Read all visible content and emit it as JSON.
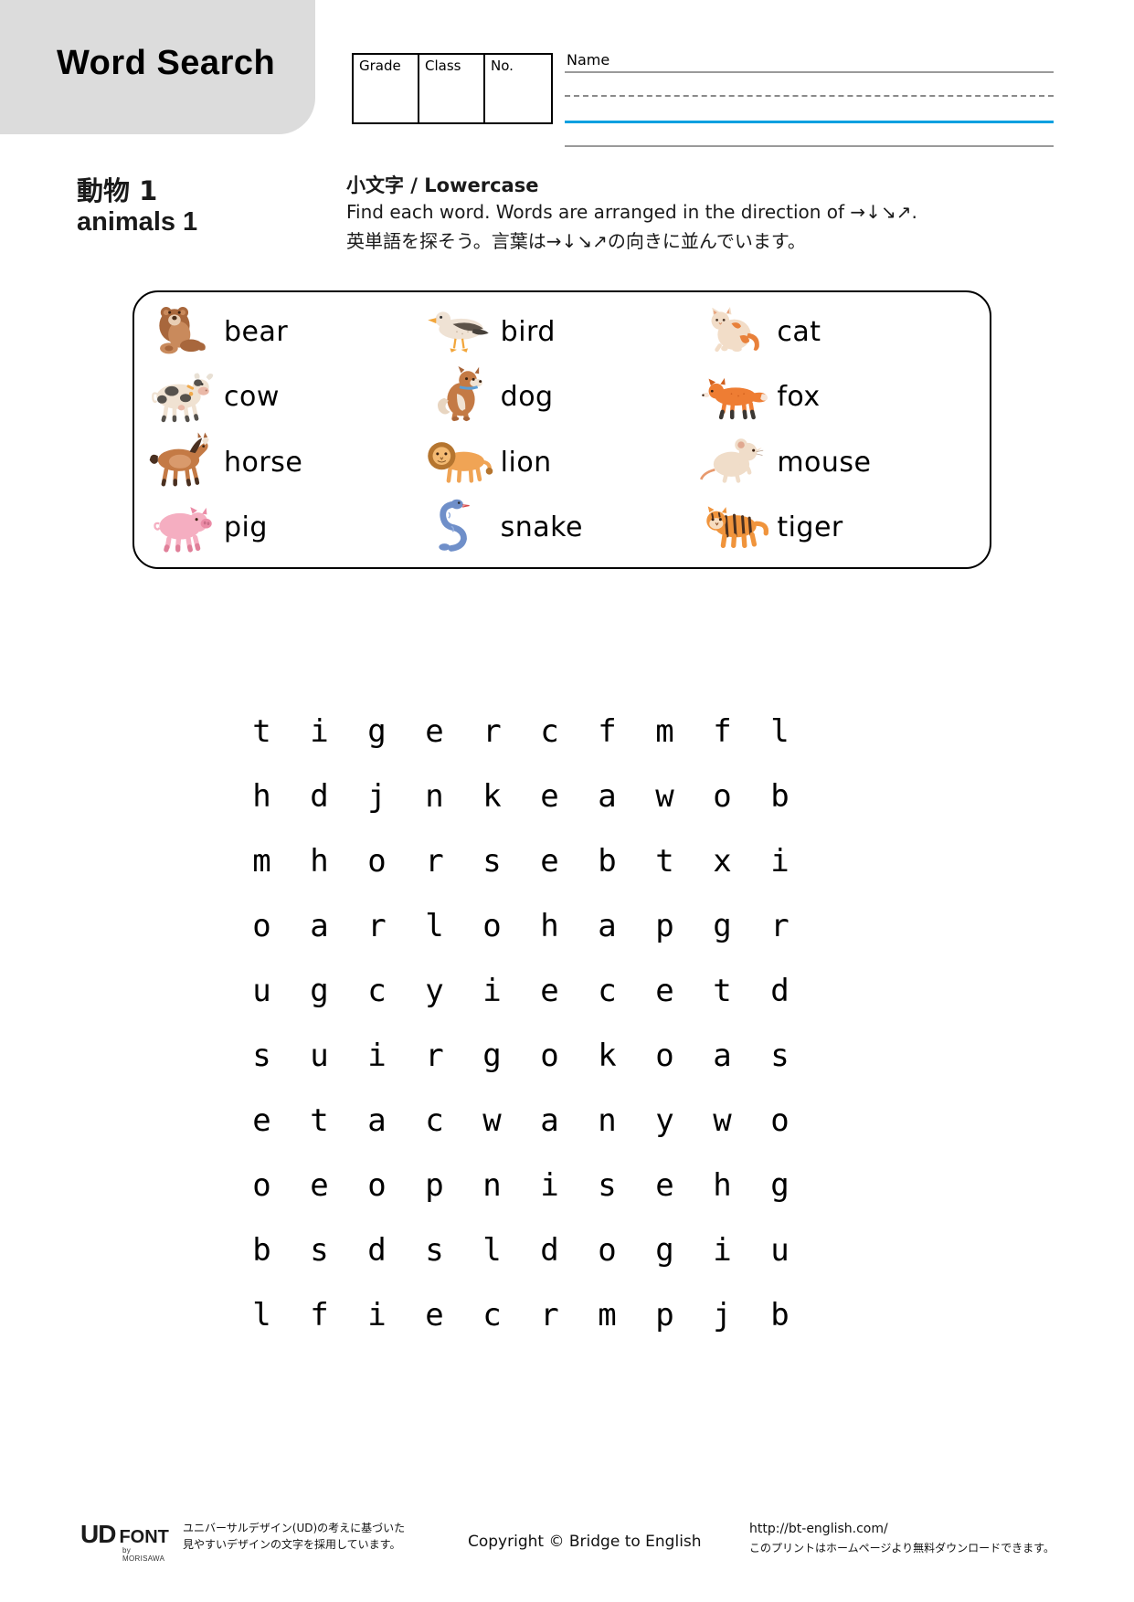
{
  "header": {
    "title": "Word Search",
    "fields": [
      {
        "label": "Grade",
        "value": ""
      },
      {
        "label": "Class",
        "value": ""
      },
      {
        "label": "No.",
        "value": ""
      }
    ],
    "name_label": "Name"
  },
  "topic": {
    "japanese": "動物 1",
    "english": "animals 1"
  },
  "instructions": {
    "title": "小文字 / Lowercase",
    "english": "Find each word.  Words are arranged in the direction of →↓↘↗.",
    "japanese": "英単語を探そう。言葉は→↓↘↗の向きに並んでいます。"
  },
  "word_list": [
    {
      "word": "bear",
      "icon": "bear-illustration"
    },
    {
      "word": "bird",
      "icon": "bird-illustration"
    },
    {
      "word": "cat",
      "icon": "cat-illustration"
    },
    {
      "word": "cow",
      "icon": "cow-illustration"
    },
    {
      "word": "dog",
      "icon": "dog-illustration"
    },
    {
      "word": "fox",
      "icon": "fox-illustration"
    },
    {
      "word": "horse",
      "icon": "horse-illustration"
    },
    {
      "word": "lion",
      "icon": "lion-illustration"
    },
    {
      "word": "mouse",
      "icon": "mouse-illustration"
    },
    {
      "word": "pig",
      "icon": "pig-illustration"
    },
    {
      "word": "snake",
      "icon": "snake-illustration"
    },
    {
      "word": "tiger",
      "icon": "tiger-illustration"
    }
  ],
  "puzzle": {
    "rows": 10,
    "cols": 10,
    "letters": [
      [
        "t",
        "i",
        "g",
        "e",
        "r",
        "c",
        "f",
        "m",
        "f",
        "l"
      ],
      [
        "h",
        "d",
        "j",
        "n",
        "k",
        "e",
        "a",
        "w",
        "o",
        "b"
      ],
      [
        "m",
        "h",
        "o",
        "r",
        "s",
        "e",
        "b",
        "t",
        "x",
        "i"
      ],
      [
        "o",
        "a",
        "r",
        "l",
        "o",
        "h",
        "a",
        "p",
        "g",
        "r"
      ],
      [
        "u",
        "g",
        "c",
        "y",
        "i",
        "e",
        "c",
        "e",
        "t",
        "d"
      ],
      [
        "s",
        "u",
        "i",
        "r",
        "g",
        "o",
        "k",
        "o",
        "a",
        "s"
      ],
      [
        "e",
        "t",
        "a",
        "c",
        "w",
        "a",
        "n",
        "y",
        "w",
        "o"
      ],
      [
        "o",
        "e",
        "o",
        "p",
        "n",
        "i",
        "s",
        "e",
        "h",
        "g"
      ],
      [
        "b",
        "s",
        "d",
        "s",
        "l",
        "d",
        "o",
        "g",
        "i",
        "u"
      ],
      [
        "l",
        "f",
        "i",
        "e",
        "c",
        "r",
        "m",
        "p",
        "j",
        "b"
      ]
    ]
  },
  "footer": {
    "ud_mark": "UD",
    "ud_font": "FONT",
    "ud_by": "by MORISAWA",
    "ud_desc_line1": "ユニバーサルデザイン(UD)の考えに基づいた",
    "ud_desc_line2": "見やすいデザインの文字を採用しています。",
    "copyright": "Copyright © Bridge to English",
    "site_url": "http://bt-english.com/",
    "site_note": "このプリントはホームページより無料ダウンロードできます。"
  },
  "colors": {
    "header_band": "#dcdcdc",
    "name_blue_line": "#00a0e0",
    "name_gray_line": "#9a9a9a"
  }
}
